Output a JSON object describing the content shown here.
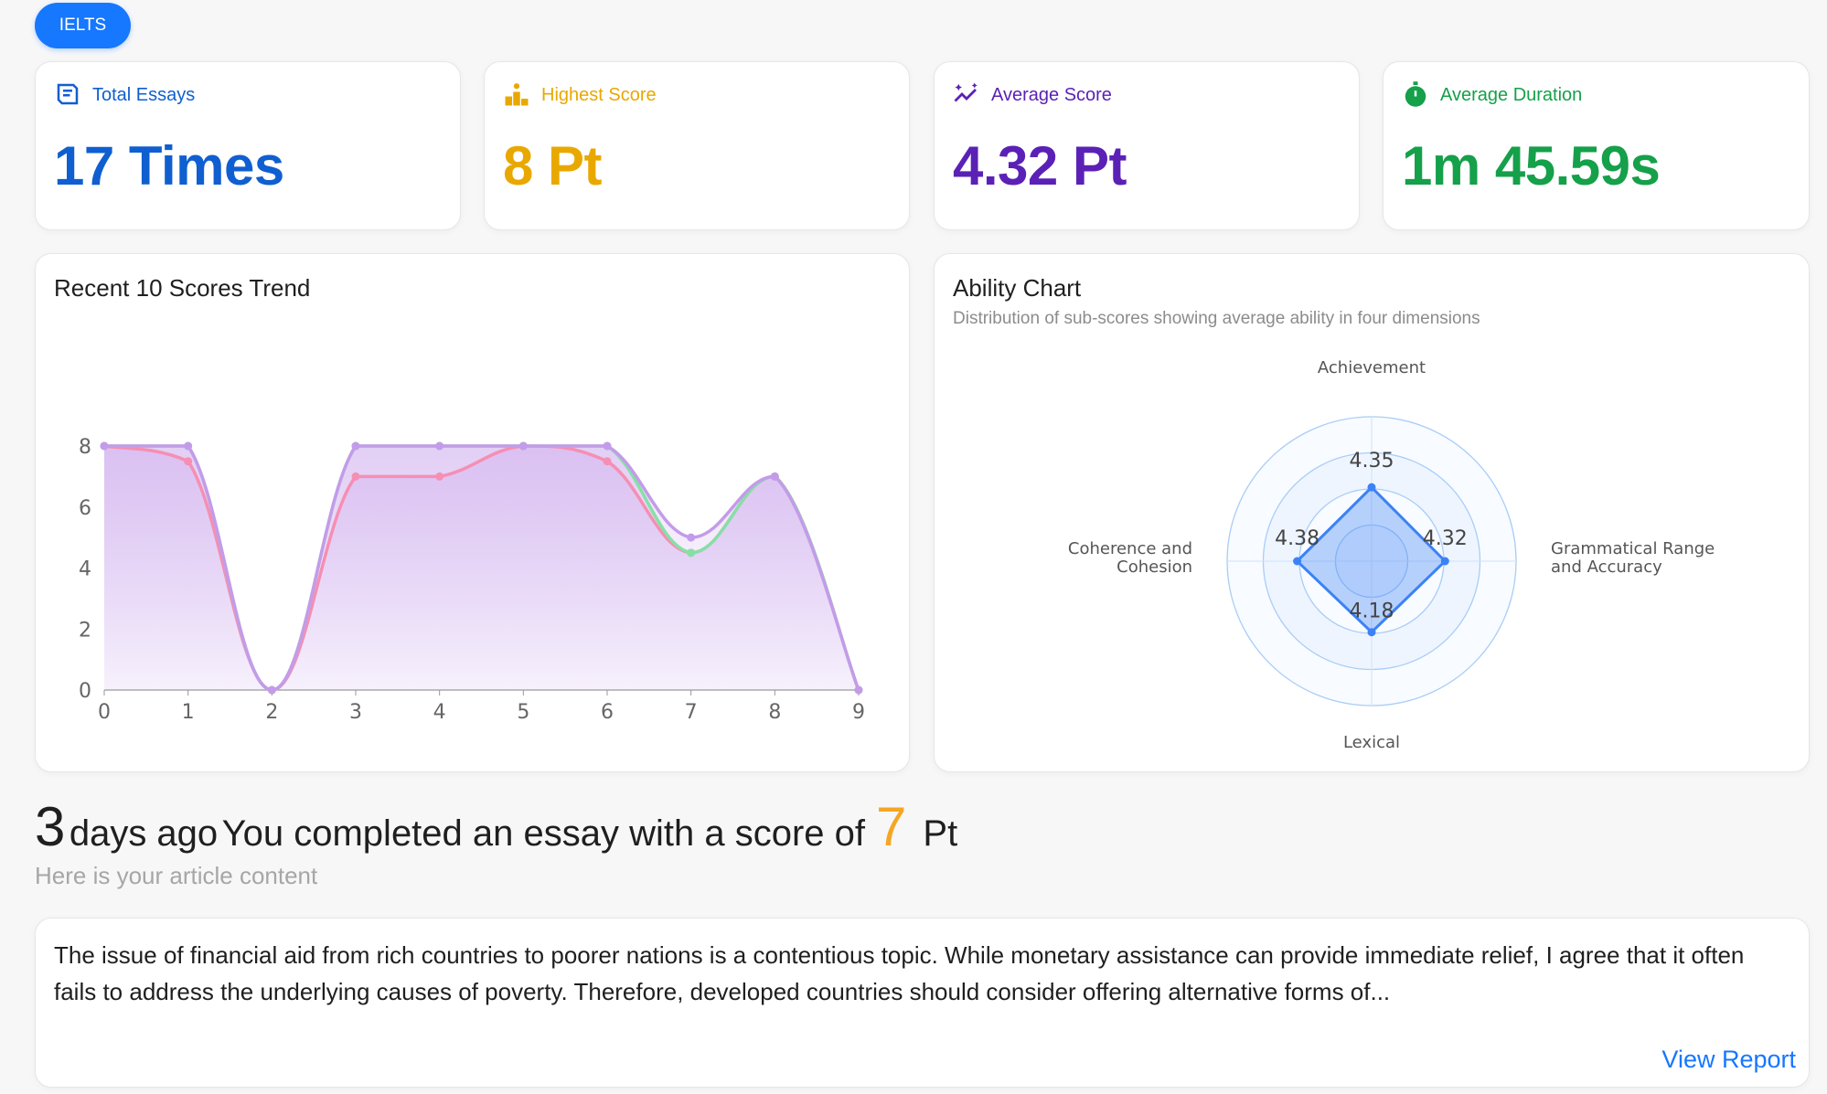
{
  "tab": {
    "label": "IELTS"
  },
  "stats": [
    {
      "label": "Total Essays",
      "value": "17 Times",
      "color": "#0f5fd0",
      "icon": "essay-book-icon"
    },
    {
      "label": "Highest Score",
      "value": "8 Pt",
      "color": "#e9a800",
      "icon": "podium-icon"
    },
    {
      "label": "Average Score",
      "value": "4.32 Pt",
      "color": "#5b21b6",
      "icon": "sparkle-trend-icon"
    },
    {
      "label": "Average Duration",
      "value": "1m 45.59s",
      "color": "#15a04a",
      "icon": "stopwatch-icon"
    }
  ],
  "trend": {
    "title": "Recent 10 Scores Trend"
  },
  "ability": {
    "title": "Ability Chart",
    "subtitle": "Distribution of sub-scores showing average ability in four dimensions"
  },
  "chart_data": [
    {
      "type": "line",
      "title": "Recent 10 Scores Trend",
      "x": [
        0,
        1,
        2,
        3,
        4,
        5,
        6,
        7,
        8,
        9
      ],
      "ylim": [
        0,
        8
      ],
      "yticks": [
        0,
        2,
        4,
        6,
        8
      ],
      "grid": false,
      "series": [
        {
          "values": [
            8,
            7.5,
            0,
            7,
            7,
            8,
            7.5,
            4.5,
            7,
            0
          ],
          "color": "#f58fb3"
        },
        {
          "values": [
            8,
            8,
            0,
            8,
            8,
            8,
            8,
            4.5,
            7,
            0
          ],
          "color": "#86e0a6"
        },
        {
          "values": [
            8,
            8,
            0,
            8,
            8,
            8,
            8,
            5,
            7,
            0
          ],
          "color": "#c49bea"
        }
      ]
    },
    {
      "type": "radar",
      "title": "Ability Chart",
      "axes": [
        "Achievement",
        "Grammatical Range and Accuracy",
        "Lexical",
        "Coherence and Cohesion"
      ],
      "axis_lines": [
        [
          "Achievement"
        ],
        [
          "Grammatical Range",
          "and Accuracy"
        ],
        [
          "Lexical"
        ],
        [
          "Coherence and",
          "Cohesion"
        ]
      ],
      "values": [
        4.35,
        4.32,
        4.18,
        4.38
      ],
      "value_labels": [
        "4.35",
        "4.32",
        "4.18",
        "4.38"
      ],
      "rmax": 8.5,
      "rings": 4,
      "color": "#3b82f6"
    }
  ],
  "latest": {
    "days": "3",
    "ago_text": "days ago",
    "sentence": "You completed an essay with a score of",
    "score": "7",
    "unit": "Pt",
    "intro": "Here is your article content",
    "essay": "The issue of financial aid from rich countries to poorer nations is a contentious topic. While monetary assistance can provide immediate relief, I agree that it often fails to address the underlying causes of poverty. Therefore, developed countries should consider offering alternative forms of...",
    "view_report": "View Report"
  }
}
